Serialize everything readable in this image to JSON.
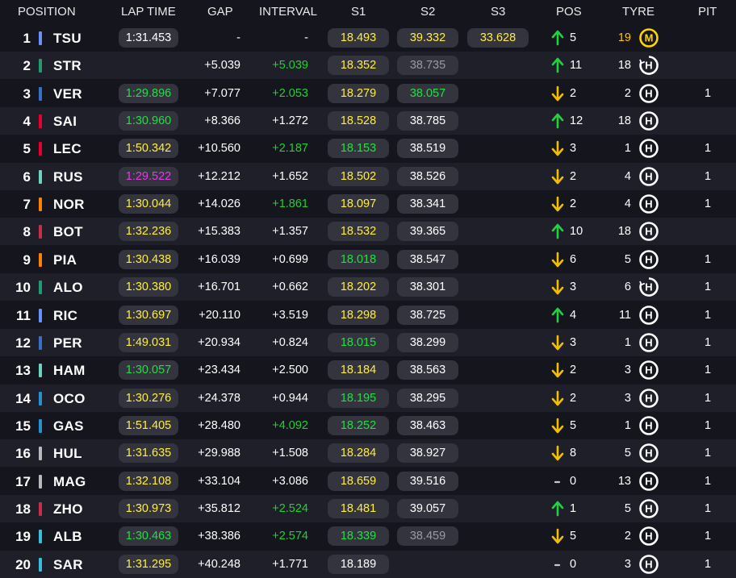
{
  "colors": {
    "yellow": "#ffee3a",
    "green": "#20e040",
    "purple": "#e43be4",
    "white": "#ffffff",
    "grey": "#9a9aa4",
    "gold": "#ffc400",
    "up_arrow": "#22d040",
    "down_arrow": "#f0c000",
    "tyre_hard": "#ffffff",
    "tyre_medium": "#ffd400"
  },
  "headers": {
    "position": "POSITION",
    "lap_time": "LAP TIME",
    "gap": "GAP",
    "interval": "INTERVAL",
    "s1": "S1",
    "s2": "S2",
    "s3": "S3",
    "pos": "POS",
    "tyre": "TYRE",
    "pit": "PIT"
  },
  "rows": [
    {
      "pos": "1",
      "driver": "TSU",
      "team_color": "#6692ff",
      "lap": "1:31.453",
      "lap_color": "white",
      "gap": "-",
      "interval": "-",
      "interval_color": "white",
      "s1": "18.493",
      "s1_color": "yellow",
      "s2": "39.332",
      "s2_color": "yellow",
      "s3": "33.628",
      "s3_color": "yellow",
      "pos_dir": "up",
      "pos_change": "5",
      "tyre_laps": "19",
      "tyre_laps_color": "gold",
      "tyre": "medium",
      "tyre_label": "M",
      "tyre_used": false,
      "pit": ""
    },
    {
      "pos": "2",
      "driver": "STR",
      "team_color": "#229971",
      "lap": "",
      "lap_color": "white",
      "gap": "+5.039",
      "interval": "+5.039",
      "interval_color": "green",
      "s1": "18.352",
      "s1_color": "yellow",
      "s2": "38.735",
      "s2_color": "grey",
      "s3": "",
      "s3_color": "white",
      "pos_dir": "up",
      "pos_change": "11",
      "tyre_laps": "18",
      "tyre_laps_color": "white",
      "tyre": "hard",
      "tyre_label": "H",
      "tyre_used": true,
      "pit": ""
    },
    {
      "pos": "3",
      "driver": "VER",
      "team_color": "#3671c6",
      "lap": "1:29.896",
      "lap_color": "green",
      "gap": "+7.077",
      "interval": "+2.053",
      "interval_color": "green",
      "s1": "18.279",
      "s1_color": "yellow",
      "s2": "38.057",
      "s2_color": "green",
      "s3": "",
      "s3_color": "white",
      "pos_dir": "down",
      "pos_change": "2",
      "tyre_laps": "2",
      "tyre_laps_color": "white",
      "tyre": "hard",
      "tyre_label": "H",
      "tyre_used": false,
      "pit": "1"
    },
    {
      "pos": "4",
      "driver": "SAI",
      "team_color": "#e8002d",
      "lap": "1:30.960",
      "lap_color": "green",
      "gap": "+8.366",
      "interval": "+1.272",
      "interval_color": "white",
      "s1": "18.528",
      "s1_color": "yellow",
      "s2": "38.785",
      "s2_color": "white",
      "s3": "",
      "s3_color": "white",
      "pos_dir": "up",
      "pos_change": "12",
      "tyre_laps": "18",
      "tyre_laps_color": "white",
      "tyre": "hard",
      "tyre_label": "H",
      "tyre_used": false,
      "pit": ""
    },
    {
      "pos": "5",
      "driver": "LEC",
      "team_color": "#e8002d",
      "lap": "1:50.342",
      "lap_color": "yellow",
      "gap": "+10.560",
      "interval": "+2.187",
      "interval_color": "green",
      "s1": "18.153",
      "s1_color": "green",
      "s2": "38.519",
      "s2_color": "white",
      "s3": "",
      "s3_color": "white",
      "pos_dir": "down",
      "pos_change": "3",
      "tyre_laps": "1",
      "tyre_laps_color": "white",
      "tyre": "hard",
      "tyre_label": "H",
      "tyre_used": false,
      "pit": "1"
    },
    {
      "pos": "6",
      "driver": "RUS",
      "team_color": "#6cd3bf",
      "lap": "1:29.522",
      "lap_color": "purple",
      "gap": "+12.212",
      "interval": "+1.652",
      "interval_color": "white",
      "s1": "18.502",
      "s1_color": "yellow",
      "s2": "38.526",
      "s2_color": "white",
      "s3": "",
      "s3_color": "white",
      "pos_dir": "down",
      "pos_change": "2",
      "tyre_laps": "4",
      "tyre_laps_color": "white",
      "tyre": "hard",
      "tyre_label": "H",
      "tyre_used": false,
      "pit": "1"
    },
    {
      "pos": "7",
      "driver": "NOR",
      "team_color": "#ff8000",
      "lap": "1:30.044",
      "lap_color": "yellow",
      "gap": "+14.026",
      "interval": "+1.861",
      "interval_color": "green",
      "s1": "18.097",
      "s1_color": "yellow",
      "s2": "38.341",
      "s2_color": "white",
      "s3": "",
      "s3_color": "white",
      "pos_dir": "down",
      "pos_change": "2",
      "tyre_laps": "4",
      "tyre_laps_color": "white",
      "tyre": "hard",
      "tyre_label": "H",
      "tyre_used": false,
      "pit": "1"
    },
    {
      "pos": "8",
      "driver": "BOT",
      "team_color": "#c92d4b",
      "lap": "1:32.236",
      "lap_color": "yellow",
      "gap": "+15.383",
      "interval": "+1.357",
      "interval_color": "white",
      "s1": "18.532",
      "s1_color": "yellow",
      "s2": "39.365",
      "s2_color": "white",
      "s3": "",
      "s3_color": "white",
      "pos_dir": "up",
      "pos_change": "10",
      "tyre_laps": "18",
      "tyre_laps_color": "white",
      "tyre": "hard",
      "tyre_label": "H",
      "tyre_used": false,
      "pit": ""
    },
    {
      "pos": "9",
      "driver": "PIA",
      "team_color": "#ff8000",
      "lap": "1:30.438",
      "lap_color": "yellow",
      "gap": "+16.039",
      "interval": "+0.699",
      "interval_color": "white",
      "s1": "18.018",
      "s1_color": "green",
      "s2": "38.547",
      "s2_color": "white",
      "s3": "",
      "s3_color": "white",
      "pos_dir": "down",
      "pos_change": "6",
      "tyre_laps": "5",
      "tyre_laps_color": "white",
      "tyre": "hard",
      "tyre_label": "H",
      "tyre_used": false,
      "pit": "1"
    },
    {
      "pos": "10",
      "driver": "ALO",
      "team_color": "#229971",
      "lap": "1:30.380",
      "lap_color": "yellow",
      "gap": "+16.701",
      "interval": "+0.662",
      "interval_color": "white",
      "s1": "18.202",
      "s1_color": "yellow",
      "s2": "38.301",
      "s2_color": "white",
      "s3": "",
      "s3_color": "white",
      "pos_dir": "down",
      "pos_change": "3",
      "tyre_laps": "6",
      "tyre_laps_color": "white",
      "tyre": "hard",
      "tyre_label": "H",
      "tyre_used": true,
      "pit": "1"
    },
    {
      "pos": "11",
      "driver": "RIC",
      "team_color": "#6692ff",
      "lap": "1:30.697",
      "lap_color": "yellow",
      "gap": "+20.110",
      "interval": "+3.519",
      "interval_color": "white",
      "s1": "18.298",
      "s1_color": "yellow",
      "s2": "38.725",
      "s2_color": "white",
      "s3": "",
      "s3_color": "white",
      "pos_dir": "up",
      "pos_change": "4",
      "tyre_laps": "11",
      "tyre_laps_color": "white",
      "tyre": "hard",
      "tyre_label": "H",
      "tyre_used": false,
      "pit": "1"
    },
    {
      "pos": "12",
      "driver": "PER",
      "team_color": "#3671c6",
      "lap": "1:49.031",
      "lap_color": "yellow",
      "gap": "+20.934",
      "interval": "+0.824",
      "interval_color": "white",
      "s1": "18.015",
      "s1_color": "green",
      "s2": "38.299",
      "s2_color": "white",
      "s3": "",
      "s3_color": "white",
      "pos_dir": "down",
      "pos_change": "3",
      "tyre_laps": "1",
      "tyre_laps_color": "white",
      "tyre": "hard",
      "tyre_label": "H",
      "tyre_used": false,
      "pit": "1"
    },
    {
      "pos": "13",
      "driver": "HAM",
      "team_color": "#6cd3bf",
      "lap": "1:30.057",
      "lap_color": "green",
      "gap": "+23.434",
      "interval": "+2.500",
      "interval_color": "white",
      "s1": "18.184",
      "s1_color": "yellow",
      "s2": "38.563",
      "s2_color": "white",
      "s3": "",
      "s3_color": "white",
      "pos_dir": "down",
      "pos_change": "2",
      "tyre_laps": "3",
      "tyre_laps_color": "white",
      "tyre": "hard",
      "tyre_label": "H",
      "tyre_used": false,
      "pit": "1"
    },
    {
      "pos": "14",
      "driver": "OCO",
      "team_color": "#2293d1",
      "lap": "1:30.276",
      "lap_color": "yellow",
      "gap": "+24.378",
      "interval": "+0.944",
      "interval_color": "white",
      "s1": "18.195",
      "s1_color": "green",
      "s2": "38.295",
      "s2_color": "white",
      "s3": "",
      "s3_color": "white",
      "pos_dir": "down",
      "pos_change": "2",
      "tyre_laps": "3",
      "tyre_laps_color": "white",
      "tyre": "hard",
      "tyre_label": "H",
      "tyre_used": false,
      "pit": "1"
    },
    {
      "pos": "15",
      "driver": "GAS",
      "team_color": "#2293d1",
      "lap": "1:51.405",
      "lap_color": "yellow",
      "gap": "+28.480",
      "interval": "+4.092",
      "interval_color": "green",
      "s1": "18.252",
      "s1_color": "green",
      "s2": "38.463",
      "s2_color": "white",
      "s3": "",
      "s3_color": "white",
      "pos_dir": "down",
      "pos_change": "5",
      "tyre_laps": "1",
      "tyre_laps_color": "white",
      "tyre": "hard",
      "tyre_label": "H",
      "tyre_used": false,
      "pit": "1"
    },
    {
      "pos": "16",
      "driver": "HUL",
      "team_color": "#b6babd",
      "lap": "1:31.635",
      "lap_color": "yellow",
      "gap": "+29.988",
      "interval": "+1.508",
      "interval_color": "white",
      "s1": "18.284",
      "s1_color": "yellow",
      "s2": "38.927",
      "s2_color": "white",
      "s3": "",
      "s3_color": "white",
      "pos_dir": "down",
      "pos_change": "8",
      "tyre_laps": "5",
      "tyre_laps_color": "white",
      "tyre": "hard",
      "tyre_label": "H",
      "tyre_used": false,
      "pit": "1"
    },
    {
      "pos": "17",
      "driver": "MAG",
      "team_color": "#b6babd",
      "lap": "1:32.108",
      "lap_color": "yellow",
      "gap": "+33.104",
      "interval": "+3.086",
      "interval_color": "white",
      "s1": "18.659",
      "s1_color": "yellow",
      "s2": "39.516",
      "s2_color": "white",
      "s3": "",
      "s3_color": "white",
      "pos_dir": "same",
      "pos_change": "0",
      "tyre_laps": "13",
      "tyre_laps_color": "white",
      "tyre": "hard",
      "tyre_label": "H",
      "tyre_used": false,
      "pit": "1"
    },
    {
      "pos": "18",
      "driver": "ZHO",
      "team_color": "#c92d4b",
      "lap": "1:30.973",
      "lap_color": "yellow",
      "gap": "+35.812",
      "interval": "+2.524",
      "interval_color": "green",
      "s1": "18.481",
      "s1_color": "yellow",
      "s2": "39.057",
      "s2_color": "white",
      "s3": "",
      "s3_color": "white",
      "pos_dir": "up",
      "pos_change": "1",
      "tyre_laps": "5",
      "tyre_laps_color": "white",
      "tyre": "hard",
      "tyre_label": "H",
      "tyre_used": false,
      "pit": "1"
    },
    {
      "pos": "19",
      "driver": "ALB",
      "team_color": "#37bedd",
      "lap": "1:30.463",
      "lap_color": "green",
      "gap": "+38.386",
      "interval": "+2.574",
      "interval_color": "green",
      "s1": "18.339",
      "s1_color": "green",
      "s2": "38.459",
      "s2_color": "grey",
      "s3": "",
      "s3_color": "white",
      "pos_dir": "down",
      "pos_change": "5",
      "tyre_laps": "2",
      "tyre_laps_color": "white",
      "tyre": "hard",
      "tyre_label": "H",
      "tyre_used": false,
      "pit": "1"
    },
    {
      "pos": "20",
      "driver": "SAR",
      "team_color": "#37bedd",
      "lap": "1:31.295",
      "lap_color": "yellow",
      "gap": "+40.248",
      "interval": "+1.771",
      "interval_color": "white",
      "s1": "18.189",
      "s1_color": "white",
      "s2": "",
      "s2_color": "white",
      "s3": "",
      "s3_color": "white",
      "pos_dir": "same",
      "pos_change": "0",
      "tyre_laps": "3",
      "tyre_laps_color": "white",
      "tyre": "hard",
      "tyre_label": "H",
      "tyre_used": false,
      "pit": "1"
    }
  ]
}
